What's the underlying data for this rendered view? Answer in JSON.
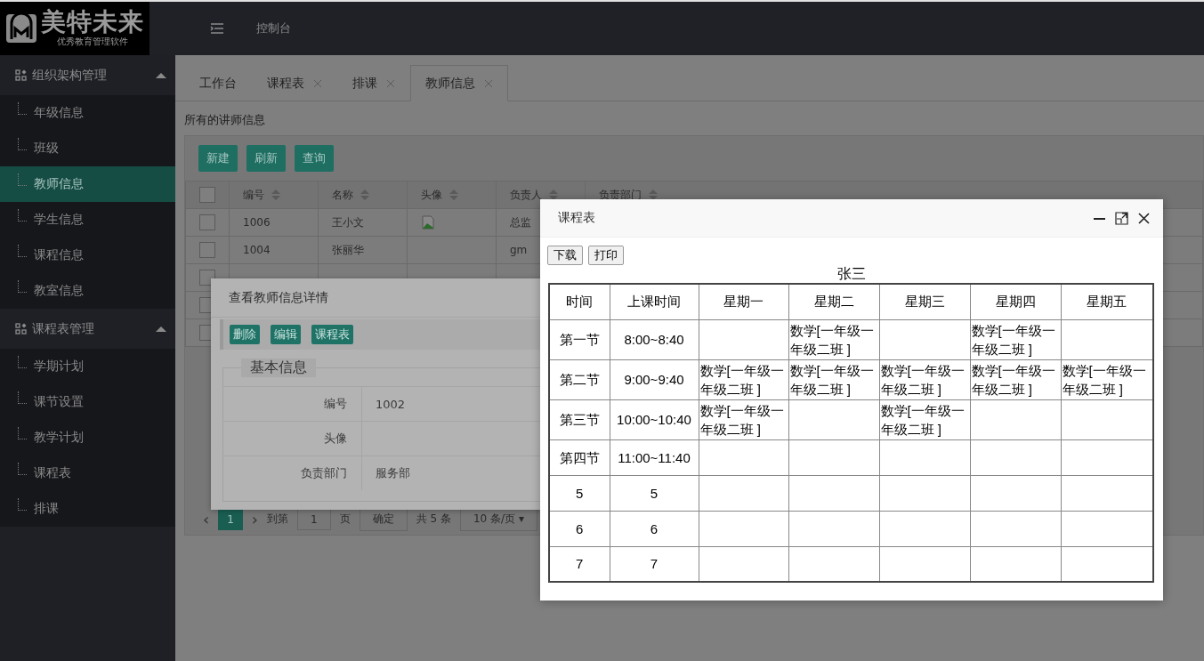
{
  "logo": {
    "name": "美特未来",
    "tagline": "优秀教育管理软件"
  },
  "header": {
    "nav": [
      "控制台"
    ]
  },
  "sidebar": {
    "groups": [
      {
        "title": "组织架构管理",
        "expanded": true,
        "items": [
          {
            "label": "年级信息",
            "selected": false
          },
          {
            "label": "班级",
            "selected": false
          },
          {
            "label": "教师信息",
            "selected": true
          },
          {
            "label": "学生信息",
            "selected": false
          },
          {
            "label": "课程信息",
            "selected": false
          },
          {
            "label": "教室信息",
            "selected": false
          }
        ]
      },
      {
        "title": "课程表管理",
        "expanded": true,
        "items": [
          {
            "label": "学期计划",
            "selected": false
          },
          {
            "label": "课节设置",
            "selected": false
          },
          {
            "label": "教学计划",
            "selected": false
          },
          {
            "label": "课程表",
            "selected": false
          },
          {
            "label": "排课",
            "selected": false
          }
        ]
      }
    ]
  },
  "tabs": [
    {
      "label": "工作台",
      "closable": false,
      "selected": false
    },
    {
      "label": "课程表",
      "closable": true,
      "selected": false
    },
    {
      "label": "排课",
      "closable": true,
      "selected": false
    },
    {
      "label": "教师信息",
      "closable": true,
      "selected": true
    }
  ],
  "page_title": "所有的讲师信息",
  "toolbar": [
    "新建",
    "刷新",
    "查询"
  ],
  "table": {
    "all_checked": false,
    "columns": [
      "编号",
      "名称",
      "头像",
      "负责人",
      "负责部门"
    ],
    "rows": [
      {
        "cells": [
          "1006",
          "王小文",
          "",
          "总监"
        ],
        "broken_image": true,
        "checked": false
      },
      {
        "cells": [
          "1004",
          "张丽华",
          "",
          "gm"
        ],
        "checked": false
      },
      {
        "cells": [],
        "checked": false
      },
      {
        "cells": [],
        "checked": false
      },
      {
        "cells": [],
        "checked": false
      }
    ]
  },
  "pagination": {
    "prev": "‹",
    "current": "1",
    "next": "›",
    "goto_label": "到第",
    "goto_value": "1",
    "page_label": "页",
    "confirm": "确定",
    "total": "共 5 条",
    "page_size": "10 条/页",
    "caret": "▾"
  },
  "detail_dialog": {
    "title": "查看教师信息详情",
    "actions": [
      "删除",
      "编辑",
      "课程表"
    ],
    "section": "基本信息",
    "fields": [
      {
        "label": "编号",
        "value": "1002"
      },
      {
        "label": "头像"
      },
      {
        "label": "负责部门",
        "value": "服务部"
      }
    ]
  },
  "schedule_dialog": {
    "title": "课程表",
    "actions": [
      "下载",
      "打印"
    ],
    "teacher": "张三",
    "columns": [
      "时间",
      "上课时间",
      "星期一",
      "星期二",
      "星期三",
      "星期四",
      "星期五"
    ],
    "rows": [
      {
        "cells": [
          "第一节",
          "8:00~8:40",
          "",
          "数学[一年级一年级二班 ]",
          "",
          "数学[一年级一年级二班 ]",
          ""
        ]
      },
      {
        "cells": [
          "第二节",
          "9:00~9:40",
          "数学[一年级一年级二班 ]",
          "数学[一年级一年级二班 ]",
          "数学[一年级一年级二班 ]",
          "数学[一年级一年级二班 ]",
          "数学[一年级一年级二班 ]"
        ]
      },
      {
        "cells": [
          "第三节",
          "10:00~10:40",
          "数学[一年级一年级二班 ]",
          "",
          "数学[一年级一年级二班 ]",
          "",
          ""
        ]
      },
      {
        "cells": [
          "第四节",
          "11:00~11:40",
          "",
          "",
          "",
          "",
          ""
        ]
      },
      {
        "cells": [
          "5",
          "5",
          "",
          "",
          "",
          "",
          ""
        ]
      },
      {
        "cells": [
          "6",
          "6",
          "",
          "",
          "",
          "",
          ""
        ]
      },
      {
        "cells": [
          "7",
          "7",
          "",
          "",
          "",
          "",
          ""
        ]
      }
    ]
  }
}
